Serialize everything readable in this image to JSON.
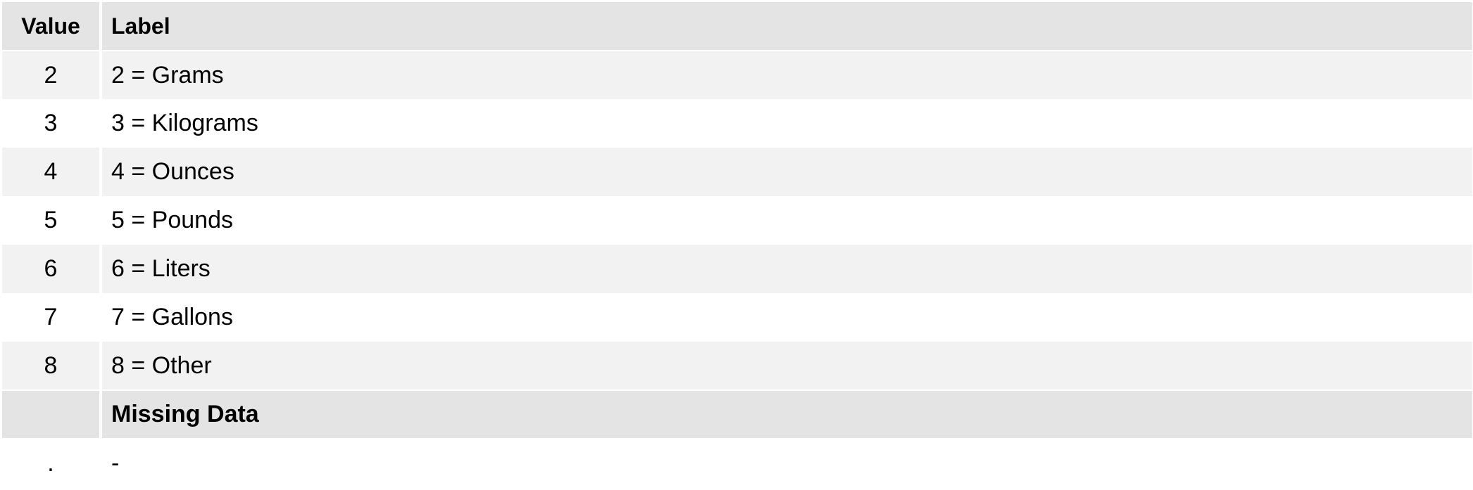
{
  "table": {
    "headers": {
      "value": "Value",
      "label": "Label"
    },
    "rows": [
      {
        "value": "2",
        "label": "2 = Grams"
      },
      {
        "value": "3",
        "label": "3 = Kilograms"
      },
      {
        "value": "4",
        "label": "4 = Ounces"
      },
      {
        "value": "5",
        "label": "5 = Pounds"
      },
      {
        "value": "6",
        "label": "6 = Liters"
      },
      {
        "value": "7",
        "label": "7 = Gallons"
      },
      {
        "value": "8",
        "label": "8 = Other"
      }
    ],
    "missing_section": {
      "title": "Missing Data",
      "rows": [
        {
          "value": ".",
          "label": "-"
        }
      ]
    }
  }
}
